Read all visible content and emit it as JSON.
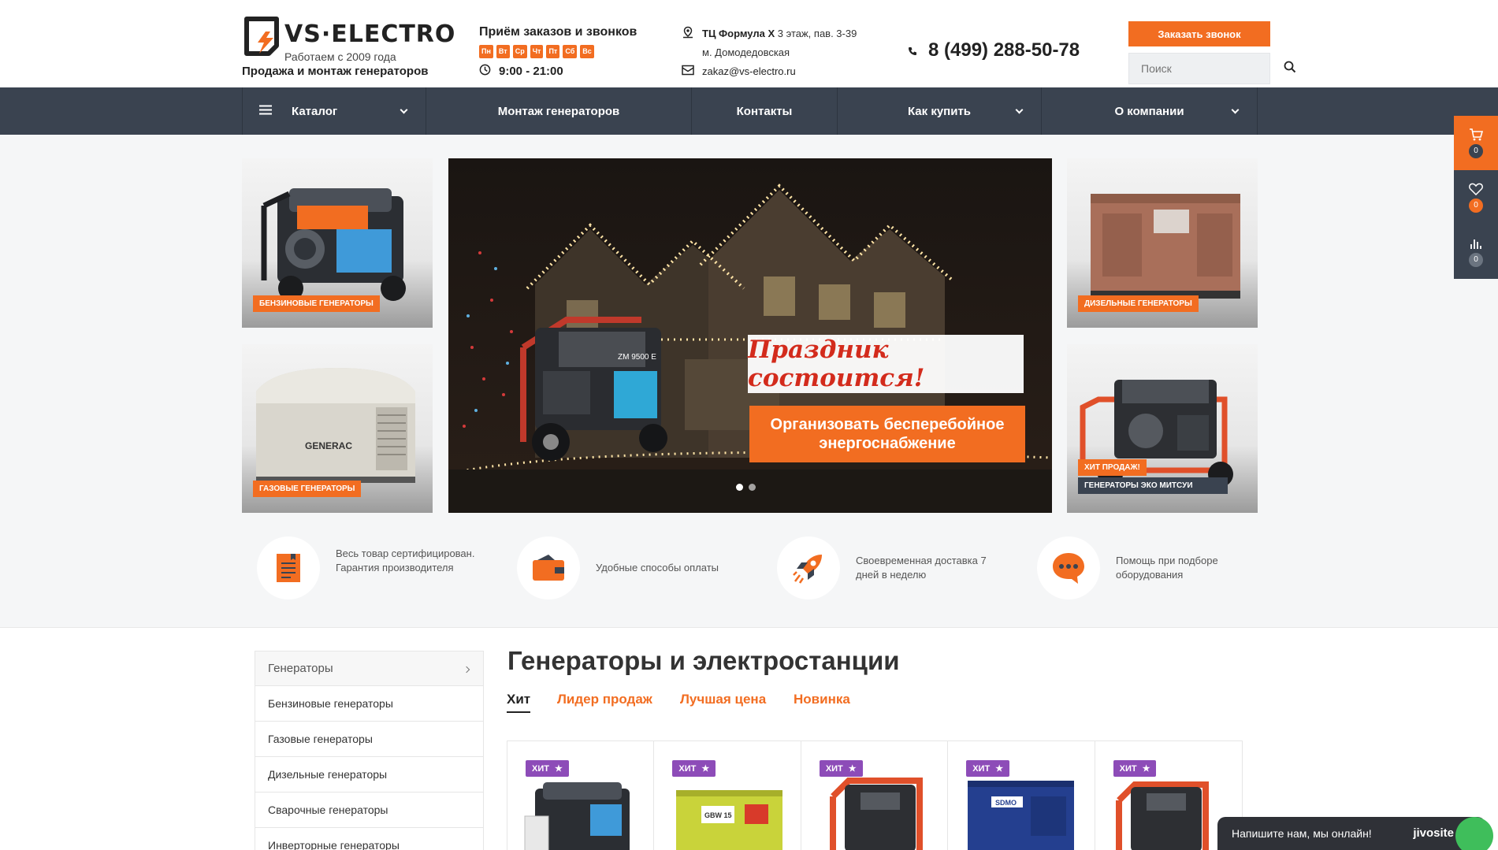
{
  "header": {
    "logo_text": "VS·ELECTRO",
    "logo_sub": "Работаем с 2009 года",
    "tagline": "Продажа и монтаж генераторов",
    "hours_title": "Приём заказов и звонков",
    "days": [
      "Пн",
      "Вт",
      "Ср",
      "Чт",
      "Пт",
      "Сб",
      "Вс"
    ],
    "hours": "9:00 - 21:00",
    "address_bold": "ТЦ Формула Х",
    "address_rest": " 3 этаж, пав. 3-39",
    "metro": "м. Домодедовская",
    "email": "zakaz@vs-electro.ru",
    "phone": "8 (499) 288-50-78",
    "call_button": "Заказать звонок",
    "search_placeholder": "Поиск"
  },
  "nav": {
    "catalog": "Каталог",
    "montazh": "Монтаж генераторов",
    "contacts": "Контакты",
    "how_to_buy": "Как купить",
    "about": "О компании"
  },
  "tiles": {
    "petrol": "БЕНЗИНОВЫЕ ГЕНЕРАТОРЫ",
    "gas": "ГАЗОВЫЕ ГЕНЕРАТОРЫ",
    "diesel": "ДИЗЕЛЬНЫЕ ГЕНЕРАТОРЫ",
    "hit_label": "ХИТ ПРОДАЖ!",
    "mitsui": "ГЕНЕРАТОРЫ ЭКО МИТСУИ",
    "generac": "GENERAC"
  },
  "banner": {
    "title": "Праздник состоится!",
    "cta_line1": "Организовать бесперебойное",
    "cta_line2": "энергоснабжение",
    "model": "ZM 9500 E",
    "active_slide": 1,
    "slides": 2
  },
  "features": [
    {
      "icon": "certificate-icon",
      "text": "Весь товар сертифицирован. Гарантия производителя"
    },
    {
      "icon": "wallet-icon",
      "text": "Удобные способы оплаты"
    },
    {
      "icon": "rocket-icon",
      "text": "Своевременная доставка 7 дней в неделю"
    },
    {
      "icon": "chat-icon",
      "text": "Помощь при подборе оборудования"
    }
  ],
  "sidebar": {
    "items": [
      "Генераторы",
      "Бензиновые генераторы",
      "Газовые генераторы",
      "Дизельные генераторы",
      "Сварочные генераторы",
      "Инверторные генераторы"
    ]
  },
  "main": {
    "title": "Генераторы и электростанции",
    "tabs": [
      "Хит",
      "Лидер продаж",
      "Лучшая цена",
      "Новинка"
    ],
    "badge": "ХИТ",
    "card_labels": [
      "GBW 15",
      "SDMO"
    ]
  },
  "side_panel": {
    "cart_count": "0",
    "wishlist_count": "0",
    "compare_count": "0"
  },
  "chat": {
    "text": "Напишите нам, мы онлайн!",
    "brand": "jivosite"
  },
  "colors": {
    "accent": "#f26d21",
    "nav_bg": "#3a4350",
    "badge": "#8d4cb8"
  }
}
